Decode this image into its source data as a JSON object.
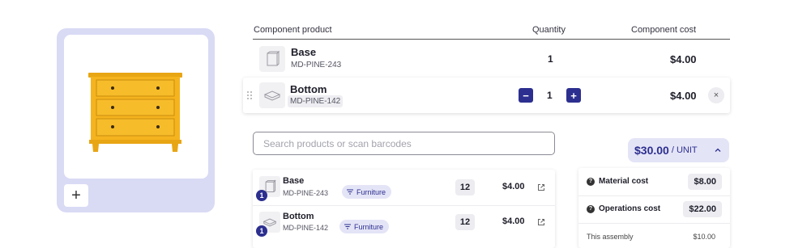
{
  "table": {
    "col_product": "Component product",
    "col_quantity": "Quantity",
    "col_cost": "Component cost"
  },
  "components": [
    {
      "name": "Base",
      "sku": "MD-PINE-243",
      "quantity": "1",
      "cost": "$4.00"
    },
    {
      "name": "Bottom",
      "sku": "MD-PINE-142",
      "quantity": "1",
      "cost": "$4.00"
    }
  ],
  "stepper": {
    "minus": "−",
    "plus": "+"
  },
  "remove_label": "×",
  "image_card": {
    "add_label": "+"
  },
  "search": {
    "placeholder": "Search products or scan barcodes",
    "value": ""
  },
  "price": {
    "value": "$30.00",
    "unit": "/ UNIT"
  },
  "results": [
    {
      "name": "Base",
      "sku": "MD-PINE-243",
      "tag": "Furniture",
      "stock": "12",
      "price": "$4.00",
      "badge": "1"
    },
    {
      "name": "Bottom",
      "sku": "MD-PINE-142",
      "tag": "Furniture",
      "stock": "12",
      "price": "$4.00",
      "badge": "1"
    }
  ],
  "costs": {
    "material_label": "Material cost",
    "material_value": "$8.00",
    "operations_label": "Operations cost",
    "operations_value": "$22.00",
    "assembly_label": "This assembly",
    "assembly_value": "$10.00"
  },
  "colors": {
    "accent": "#2c2f8f",
    "accent_light": "#e4e4f7",
    "card_bg": "#d9daf4",
    "dresser": "#f5b41e"
  }
}
